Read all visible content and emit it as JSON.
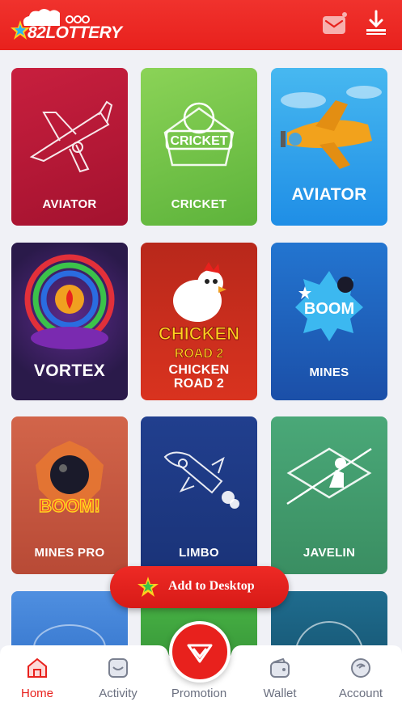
{
  "header": {
    "logo_text": "82LOTTERY",
    "mail_icon": "mail-icon",
    "download_icon": "download-icon",
    "brand_color": "#e8211d"
  },
  "games": [
    {
      "label": "AVIATOR",
      "bg": "#b81638"
    },
    {
      "label": "CRICKET",
      "bg": "#7ac74a"
    },
    {
      "label": "AVIATOR",
      "bg": "#2ba5ea"
    },
    {
      "label": "VORTEX",
      "bg": "#2a1a4a"
    },
    {
      "label": "CHICKEN\nROAD 2",
      "bg": "#c42016"
    },
    {
      "label": "MINES",
      "bg": "#1c5cb8"
    },
    {
      "label": "MINES PRO",
      "bg": "#c85a42"
    },
    {
      "label": "LIMBO",
      "bg": "#1d3a86"
    },
    {
      "label": "JAVELIN",
      "bg": "#3d9b6a"
    }
  ],
  "add_to_desktop": "Add to Desktop",
  "tabs": [
    {
      "label": "Home",
      "icon": "home-icon",
      "active": true
    },
    {
      "label": "Activity",
      "icon": "activity-icon",
      "active": false
    },
    {
      "label": "Promotion",
      "icon": "promotion-icon",
      "active": false
    },
    {
      "label": "Wallet",
      "icon": "wallet-icon",
      "active": false
    },
    {
      "label": "Account",
      "icon": "account-icon",
      "active": false
    }
  ]
}
